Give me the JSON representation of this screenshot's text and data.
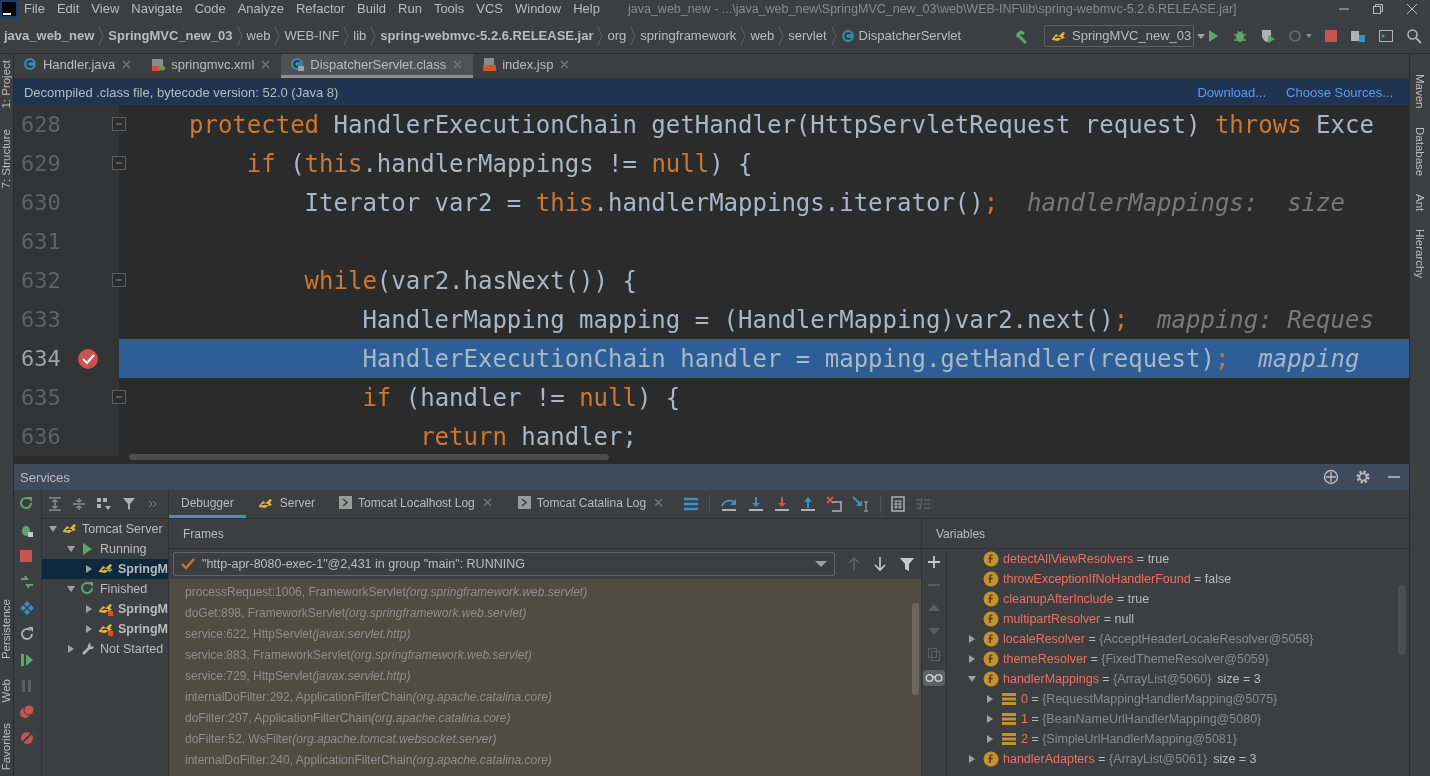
{
  "menu_bar": {
    "items": [
      "File",
      "Edit",
      "View",
      "Navigate",
      "Code",
      "Analyze",
      "Refactor",
      "Build",
      "Run",
      "Tools",
      "VCS",
      "Window",
      "Help"
    ],
    "title": "java_web_new - ...\\java_web_new\\SpringMVC_new_03\\web\\WEB-INF\\lib\\spring-webmvc-5.2.6.RELEASE.jar]"
  },
  "nav_bar": {
    "breadcrumbs": [
      {
        "label": "java_web_new",
        "kind": "project"
      },
      {
        "label": "SpringMVC_new_03",
        "kind": "module"
      },
      {
        "label": "web",
        "kind": "folder"
      },
      {
        "label": "WEB-INF",
        "kind": "folder"
      },
      {
        "label": "lib",
        "kind": "folder"
      },
      {
        "label": "spring-webmvc-5.2.6.RELEASE.jar",
        "kind": "jar"
      },
      {
        "label": "org",
        "kind": "folder"
      },
      {
        "label": "springframework",
        "kind": "folder"
      },
      {
        "label": "web",
        "kind": "folder"
      },
      {
        "label": "servlet",
        "kind": "folder"
      },
      {
        "label": "DispatcherServlet",
        "kind": "class"
      }
    ],
    "run_config": "SpringMVC_new_03"
  },
  "left_tool_strip": {
    "top": [
      "1: Project",
      "7: Structure"
    ],
    "bottom": [
      "Persistence",
      "Web",
      "Favorites"
    ]
  },
  "right_tool_strip": [
    "Maven",
    "Database",
    "Ant",
    "Hierarchy"
  ],
  "editor_tabs": [
    {
      "label": "Handler.java",
      "kind": "class",
      "selected": false
    },
    {
      "label": "springmvc.xml",
      "kind": "xml",
      "selected": false
    },
    {
      "label": "DispatcherServlet.class",
      "kind": "compiled",
      "selected": true
    },
    {
      "label": "index.jsp",
      "kind": "jsp",
      "selected": false
    }
  ],
  "decompiled_banner": {
    "message": "Decompiled .class file, bytecode version: 52.0 (Java 8)",
    "links": [
      "Download...",
      "Choose Sources..."
    ]
  },
  "editor": {
    "lines": [
      {
        "number": "628",
        "fold": true,
        "breakpoint": false,
        "execution_point": false,
        "tokens": [
          {
            "kind": "kw",
            "text": "protected"
          },
          {
            "kind": "plain",
            "text": " HandlerExecutionChain getHandler(HttpServletRequest request) "
          },
          {
            "kind": "kw",
            "text": "throws"
          },
          {
            "kind": "plain",
            "text": " Exce"
          }
        ]
      },
      {
        "number": "629",
        "fold": true,
        "breakpoint": false,
        "execution_point": false,
        "tokens": [
          {
            "kind": "kw",
            "text": "    if"
          },
          {
            "kind": "plain",
            "text": " ("
          },
          {
            "kind": "kw",
            "text": "this"
          },
          {
            "kind": "plain",
            "text": ".handlerMappings != "
          },
          {
            "kind": "kw",
            "text": "null"
          },
          {
            "kind": "plain",
            "text": ") {"
          }
        ]
      },
      {
        "number": "630",
        "fold": false,
        "breakpoint": false,
        "execution_point": false,
        "tokens": [
          {
            "kind": "plain",
            "text": "        Iterator var2 = "
          },
          {
            "kind": "kw",
            "text": "this"
          },
          {
            "kind": "plain",
            "text": ".handlerMappings.iterator()"
          },
          {
            "kind": "kw",
            "text": ";"
          },
          {
            "kind": "hint",
            "text": "  handlerMappings:  size"
          }
        ]
      },
      {
        "number": "631",
        "fold": false,
        "breakpoint": false,
        "execution_point": false
      },
      {
        "number": "632",
        "fold": true,
        "breakpoint": false,
        "execution_point": false,
        "tokens": [
          {
            "kind": "kw",
            "text": "        while"
          },
          {
            "kind": "plain",
            "text": "(var2.hasNext()) {"
          }
        ]
      },
      {
        "number": "633",
        "fold": false,
        "breakpoint": false,
        "execution_point": false,
        "tokens": [
          {
            "kind": "plain",
            "text": "            HandlerMapping mapping = (HandlerMapping)var2.next()"
          },
          {
            "kind": "kw",
            "text": ";"
          },
          {
            "kind": "hint",
            "text": "  mapping: Reques"
          }
        ]
      },
      {
        "number": "634",
        "fold": false,
        "breakpoint": true,
        "execution_point": true,
        "tokens": [
          {
            "kind": "plain",
            "text": "            HandlerExecutionChain handler = mapping.getHandler(request)"
          },
          {
            "kind": "kw",
            "text": ";"
          },
          {
            "kind": "hint",
            "text": "  mapping"
          }
        ]
      },
      {
        "number": "635",
        "fold": true,
        "breakpoint": false,
        "execution_point": false,
        "tokens": [
          {
            "kind": "kw",
            "text": "            if"
          },
          {
            "kind": "plain",
            "text": " (handler != "
          },
          {
            "kind": "kw",
            "text": "null"
          },
          {
            "kind": "plain",
            "text": ") {"
          }
        ]
      },
      {
        "number": "636",
        "fold": false,
        "breakpoint": false,
        "execution_point": false,
        "tokens": [
          {
            "kind": "kw",
            "text": "                return"
          },
          {
            "kind": "plain",
            "text": " handler;"
          }
        ]
      }
    ]
  },
  "services": {
    "title": "Services",
    "tree": [
      {
        "label": "Tomcat Server",
        "kind": "server",
        "expanded": true,
        "selected": false,
        "children": [
          {
            "label": "Running",
            "kind": "running",
            "expanded": true,
            "selected": false,
            "children": [
              {
                "label": "SpringM",
                "kind": "deployment_running",
                "expanded": false,
                "selected": true
              }
            ]
          },
          {
            "label": "Finished",
            "kind": "finished",
            "expanded": true,
            "selected": false,
            "children": [
              {
                "label": "SpringM",
                "kind": "deployment_finished",
                "expanded": false,
                "selected": false
              },
              {
                "label": "SpringM",
                "kind": "deployment_finished",
                "expanded": false,
                "selected": false
              }
            ]
          },
          {
            "label": "Not Started",
            "kind": "not_started",
            "expanded": false,
            "selected": false
          }
        ]
      }
    ],
    "debug_tabs": [
      {
        "label": "Debugger",
        "kind": "debugger",
        "selected": true,
        "closable": false
      },
      {
        "label": "Server",
        "kind": "server",
        "selected": false,
        "closable": false
      },
      {
        "label": "Tomcat Localhost Log",
        "kind": "log",
        "selected": false,
        "closable": true
      },
      {
        "label": "Tomcat Catalina Log",
        "kind": "log",
        "selected": false,
        "closable": true
      }
    ],
    "frames": {
      "title": "Frames",
      "thread": "\"http-apr-8080-exec-1\"@2,431 in group \"main\": RUNNING",
      "items": [
        {
          "method": "processRequest:1006, FrameworkServlet",
          "package": "(org.springframework.web.servlet)"
        },
        {
          "method": "doGet:898, FrameworkServlet",
          "package": "(org.springframework.web.servlet)"
        },
        {
          "method": "service:622, HttpServlet",
          "package": "(javax.servlet.http)"
        },
        {
          "method": "service:883, FrameworkServlet",
          "package": "(org.springframework.web.servlet)"
        },
        {
          "method": "service:729, HttpServlet",
          "package": "(javax.servlet.http)"
        },
        {
          "method": "internalDoFilter:292, ApplicationFilterChain",
          "package": "(org.apache.catalina.core)"
        },
        {
          "method": "doFilter:207, ApplicationFilterChain",
          "package": "(org.apache.catalina.core)"
        },
        {
          "method": "doFilter:52, WsFilter",
          "package": "(org.apache.tomcat.websocket.server)"
        },
        {
          "method": "internalDoFilter:240, ApplicationFilterChain",
          "package": "(org.apache.catalina.core)"
        }
      ]
    },
    "variables": {
      "title": "Variables",
      "items": [
        {
          "kind": "field",
          "name": "detectAllViewResolvers",
          "assign": "=",
          "value": "true"
        },
        {
          "kind": "field",
          "name": "throwExceptionIfNoHandlerFound",
          "assign": "=",
          "value": "false"
        },
        {
          "kind": "field",
          "name": "cleanupAfterInclude",
          "assign": "=",
          "value": "true"
        },
        {
          "kind": "field",
          "name": "multipartResolver",
          "assign": "=",
          "value": "null"
        },
        {
          "kind": "field",
          "name": "localeResolver",
          "assign": "=",
          "value": "{AcceptHeaderLocaleResolver@5058}",
          "expanded": false
        },
        {
          "kind": "field",
          "name": "themeResolver",
          "assign": "=",
          "value": "{FixedThemeResolver@5059}",
          "expanded": false
        },
        {
          "kind": "field",
          "name": "handlerMappings",
          "assign": "=",
          "value": "{ArrayList@5060}",
          "size": "size = 3",
          "expanded": true,
          "children": [
            {
              "kind": "element",
              "name": "0",
              "assign": "=",
              "value": "{RequestMappingHandlerMapping@5075}",
              "expanded": false
            },
            {
              "kind": "element",
              "name": "1",
              "assign": "=",
              "value": "{BeanNameUrlHandlerMapping@5080}",
              "expanded": false
            },
            {
              "kind": "element",
              "name": "2",
              "assign": "=",
              "value": "{SimpleUrlHandlerMapping@5081}",
              "expanded": false
            }
          ]
        },
        {
          "kind": "field",
          "name": "handlerAdapters",
          "assign": "=",
          "value": "{ArrayList@5061}",
          "size": "size = 3",
          "expanded": false
        }
      ]
    }
  }
}
